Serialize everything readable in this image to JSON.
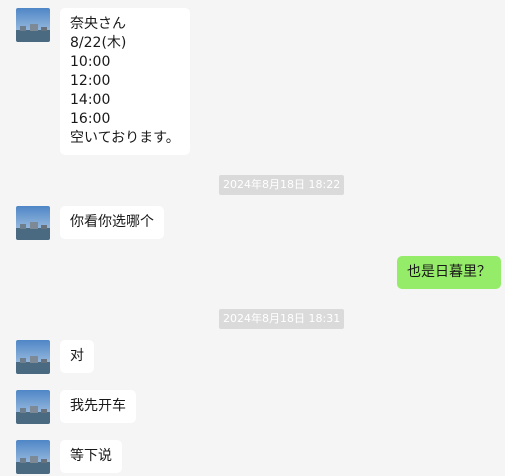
{
  "messages": [
    {
      "lines": [
        "奈央さん",
        "8/22(木)",
        "10:00",
        "12:00",
        "14:00",
        "16:00",
        "空いております。"
      ]
    },
    {
      "lines": [
        "你看你选哪个"
      ]
    },
    {
      "lines": [
        "也是日暮里？"
      ]
    },
    {
      "lines": [
        "对"
      ]
    },
    {
      "lines": [
        "我先开车"
      ]
    },
    {
      "lines": [
        "等下说"
      ]
    }
  ],
  "timestamps": [
    "2024年8月18日 18:22",
    "2024年8月18日 18:31"
  ],
  "colors": {
    "background": "#f5f5f5",
    "incoming_bubble": "#ffffff",
    "outgoing_bubble": "#95ec69",
    "timestamp_pill": "#dadada"
  }
}
